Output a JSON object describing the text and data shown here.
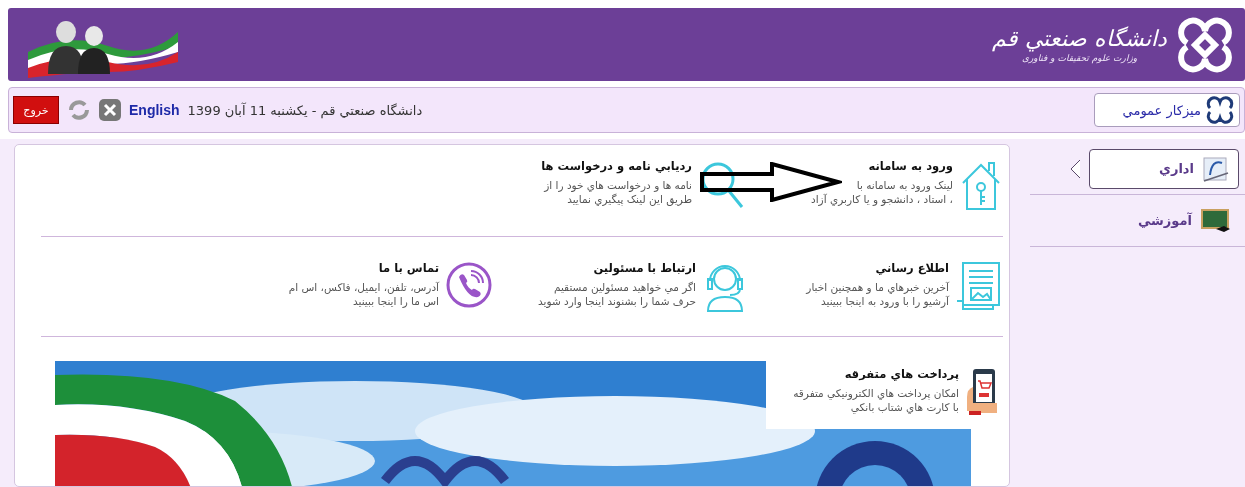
{
  "header": {
    "title": "دانشگاه صنعتي قم",
    "subtitle": "وزارت علوم تحقیقات و فناوری"
  },
  "topbar": {
    "workspace_button": "میزکار عمومي",
    "date_text": "دانشگاه صنعتي قم - يکشنبه 11 آبان 1399",
    "language_link": "English",
    "logout_button": "خروج"
  },
  "sidebar": {
    "items": [
      {
        "label": "اداري",
        "selected": true
      },
      {
        "label": "آموزشي",
        "selected": false
      }
    ]
  },
  "content": {
    "rows": [
      {
        "items": [
          {
            "title": "ورود به سامانه",
            "lines": [
              "لینک ورود به سامانه با",
              "، استاد ، دانشجو و يا کاربري آزاد"
            ]
          },
          {
            "title": "رديابي نامه و درخواست ها",
            "lines": [
              "نامه ها و درخواست هاي خود را از",
              "طريق اين لينک پيگيري نماييد"
            ]
          }
        ]
      },
      {
        "items": [
          {
            "title": "اطلاع رساني",
            "lines": [
              "آخرين خبرهاي ما و همچنين اخبار",
              "آرشيو را با ورود به اينجا ببينيد"
            ]
          },
          {
            "title": "ارتباط با مسئولين",
            "lines": [
              "اگر مي خواهيد مسئولين مستقيم",
              "حرف شما را بشنوند اينجا وارد شويد"
            ]
          },
          {
            "title": "تماس با ما",
            "lines": [
              "آدرس، تلفن، ايميل، فاکس، اس ام",
              "اس ما را اينجا ببينيد"
            ]
          }
        ]
      }
    ],
    "banner": {
      "kind": "picture",
      "overlay_item": {
        "title": "پرداخت هاي متفرقه",
        "lines": [
          "امکان پرداخت هاي الکترونيکي متفرقه",
          "با کارت هاي شتاب بانکي"
        ]
      }
    }
  }
}
